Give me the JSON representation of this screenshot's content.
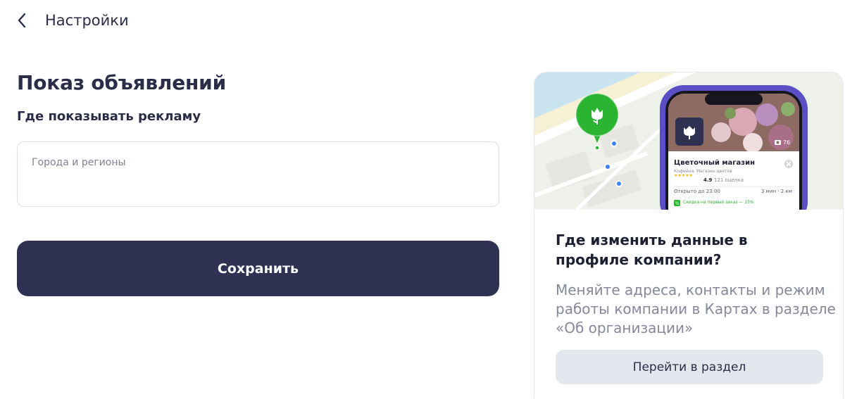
{
  "header": {
    "back_icon": "chevron-left-icon",
    "title": "Настройки"
  },
  "main": {
    "section_title": "Показ объявлений",
    "field_label": "Где показывать рекламу",
    "regions_input": {
      "value": "",
      "placeholder": "Города и регионы"
    },
    "save_label": "Сохранить",
    "save_color": "#2e3152"
  },
  "promo": {
    "image": {
      "pin_icon": "flower-icon",
      "pin_color": "#2bb431",
      "photo_count": "76",
      "place_title": "Цветочный магазин",
      "place_category": "Кофейня, Магазин цветов",
      "rating": "4.9",
      "reviews": "121 оценка",
      "hours": "Открыто до 23:00",
      "travel": "3 мин · 2 км",
      "promo_line": "Скидка на первый заказ — 15%"
    },
    "title": "Где изменить данные в профиле компании?",
    "text": "Меняйте адреса, контакты и режим работы компании в Картах в разделе «Об организации»",
    "button_label": "Перейти в раздел"
  }
}
